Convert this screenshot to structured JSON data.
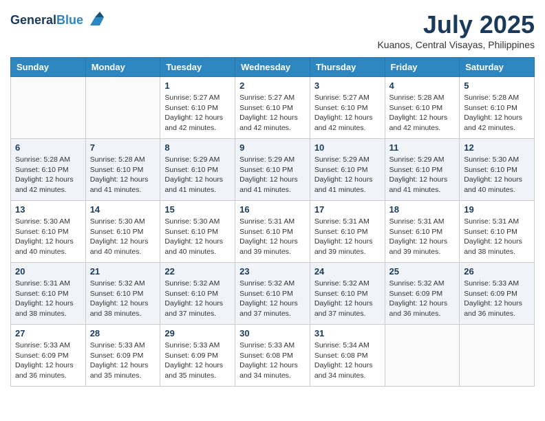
{
  "header": {
    "logo_line1": "General",
    "logo_line2": "Blue",
    "month_title": "July 2025",
    "location": "Kuanos, Central Visayas, Philippines"
  },
  "days_of_week": [
    "Sunday",
    "Monday",
    "Tuesday",
    "Wednesday",
    "Thursday",
    "Friday",
    "Saturday"
  ],
  "weeks": [
    [
      {
        "day": "",
        "info": ""
      },
      {
        "day": "",
        "info": ""
      },
      {
        "day": "1",
        "info": "Sunrise: 5:27 AM\nSunset: 6:10 PM\nDaylight: 12 hours and 42 minutes."
      },
      {
        "day": "2",
        "info": "Sunrise: 5:27 AM\nSunset: 6:10 PM\nDaylight: 12 hours and 42 minutes."
      },
      {
        "day": "3",
        "info": "Sunrise: 5:27 AM\nSunset: 6:10 PM\nDaylight: 12 hours and 42 minutes."
      },
      {
        "day": "4",
        "info": "Sunrise: 5:28 AM\nSunset: 6:10 PM\nDaylight: 12 hours and 42 minutes."
      },
      {
        "day": "5",
        "info": "Sunrise: 5:28 AM\nSunset: 6:10 PM\nDaylight: 12 hours and 42 minutes."
      }
    ],
    [
      {
        "day": "6",
        "info": "Sunrise: 5:28 AM\nSunset: 6:10 PM\nDaylight: 12 hours and 42 minutes."
      },
      {
        "day": "7",
        "info": "Sunrise: 5:28 AM\nSunset: 6:10 PM\nDaylight: 12 hours and 41 minutes."
      },
      {
        "day": "8",
        "info": "Sunrise: 5:29 AM\nSunset: 6:10 PM\nDaylight: 12 hours and 41 minutes."
      },
      {
        "day": "9",
        "info": "Sunrise: 5:29 AM\nSunset: 6:10 PM\nDaylight: 12 hours and 41 minutes."
      },
      {
        "day": "10",
        "info": "Sunrise: 5:29 AM\nSunset: 6:10 PM\nDaylight: 12 hours and 41 minutes."
      },
      {
        "day": "11",
        "info": "Sunrise: 5:29 AM\nSunset: 6:10 PM\nDaylight: 12 hours and 41 minutes."
      },
      {
        "day": "12",
        "info": "Sunrise: 5:30 AM\nSunset: 6:10 PM\nDaylight: 12 hours and 40 minutes."
      }
    ],
    [
      {
        "day": "13",
        "info": "Sunrise: 5:30 AM\nSunset: 6:10 PM\nDaylight: 12 hours and 40 minutes."
      },
      {
        "day": "14",
        "info": "Sunrise: 5:30 AM\nSunset: 6:10 PM\nDaylight: 12 hours and 40 minutes."
      },
      {
        "day": "15",
        "info": "Sunrise: 5:30 AM\nSunset: 6:10 PM\nDaylight: 12 hours and 40 minutes."
      },
      {
        "day": "16",
        "info": "Sunrise: 5:31 AM\nSunset: 6:10 PM\nDaylight: 12 hours and 39 minutes."
      },
      {
        "day": "17",
        "info": "Sunrise: 5:31 AM\nSunset: 6:10 PM\nDaylight: 12 hours and 39 minutes."
      },
      {
        "day": "18",
        "info": "Sunrise: 5:31 AM\nSunset: 6:10 PM\nDaylight: 12 hours and 39 minutes."
      },
      {
        "day": "19",
        "info": "Sunrise: 5:31 AM\nSunset: 6:10 PM\nDaylight: 12 hours and 38 minutes."
      }
    ],
    [
      {
        "day": "20",
        "info": "Sunrise: 5:31 AM\nSunset: 6:10 PM\nDaylight: 12 hours and 38 minutes."
      },
      {
        "day": "21",
        "info": "Sunrise: 5:32 AM\nSunset: 6:10 PM\nDaylight: 12 hours and 38 minutes."
      },
      {
        "day": "22",
        "info": "Sunrise: 5:32 AM\nSunset: 6:10 PM\nDaylight: 12 hours and 37 minutes."
      },
      {
        "day": "23",
        "info": "Sunrise: 5:32 AM\nSunset: 6:10 PM\nDaylight: 12 hours and 37 minutes."
      },
      {
        "day": "24",
        "info": "Sunrise: 5:32 AM\nSunset: 6:10 PM\nDaylight: 12 hours and 37 minutes."
      },
      {
        "day": "25",
        "info": "Sunrise: 5:32 AM\nSunset: 6:09 PM\nDaylight: 12 hours and 36 minutes."
      },
      {
        "day": "26",
        "info": "Sunrise: 5:33 AM\nSunset: 6:09 PM\nDaylight: 12 hours and 36 minutes."
      }
    ],
    [
      {
        "day": "27",
        "info": "Sunrise: 5:33 AM\nSunset: 6:09 PM\nDaylight: 12 hours and 36 minutes."
      },
      {
        "day": "28",
        "info": "Sunrise: 5:33 AM\nSunset: 6:09 PM\nDaylight: 12 hours and 35 minutes."
      },
      {
        "day": "29",
        "info": "Sunrise: 5:33 AM\nSunset: 6:09 PM\nDaylight: 12 hours and 35 minutes."
      },
      {
        "day": "30",
        "info": "Sunrise: 5:33 AM\nSunset: 6:08 PM\nDaylight: 12 hours and 34 minutes."
      },
      {
        "day": "31",
        "info": "Sunrise: 5:34 AM\nSunset: 6:08 PM\nDaylight: 12 hours and 34 minutes."
      },
      {
        "day": "",
        "info": ""
      },
      {
        "day": "",
        "info": ""
      }
    ]
  ]
}
